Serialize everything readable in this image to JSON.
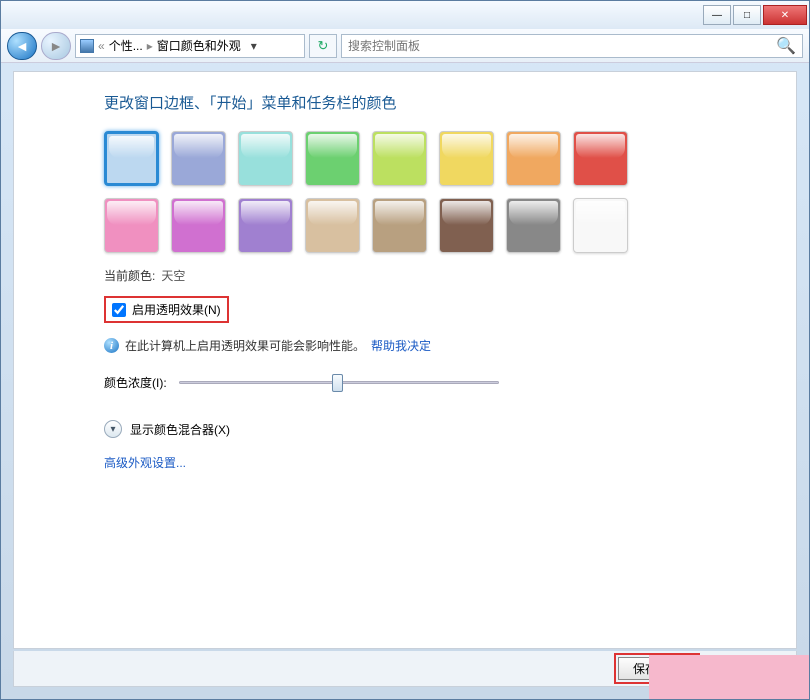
{
  "titlebar": {
    "min": "—",
    "max": "□",
    "close": "✕"
  },
  "nav": {
    "breadcrumb1": "个性...",
    "breadcrumb2": "窗口颜色和外观",
    "search_placeholder": "搜索控制面板"
  },
  "page": {
    "title": "更改窗口边框、「开始」菜单和任务栏的颜色",
    "current_color_label": "当前颜色:",
    "current_color_value": "天空",
    "checkbox_label": "启用透明效果(N)",
    "info_text": "在此计算机上启用透明效果可能会影响性能。",
    "help_link": "帮助我决定",
    "slider_label": "颜色浓度(I):",
    "expand_label": "显示颜色混合器(X)",
    "adv_link": "高级外观设置..."
  },
  "swatches": [
    "#bcd8f0",
    "#9aa8d8",
    "#98e0dc",
    "#6cd070",
    "#bce060",
    "#f0d860",
    "#f0a860",
    "#e05048",
    "#f090c0",
    "#d070d0",
    "#a080d0",
    "#d8c0a0",
    "#b8a080",
    "#806050",
    "#888888",
    "#f8f8f8"
  ],
  "footer": {
    "save": "保存修改"
  }
}
